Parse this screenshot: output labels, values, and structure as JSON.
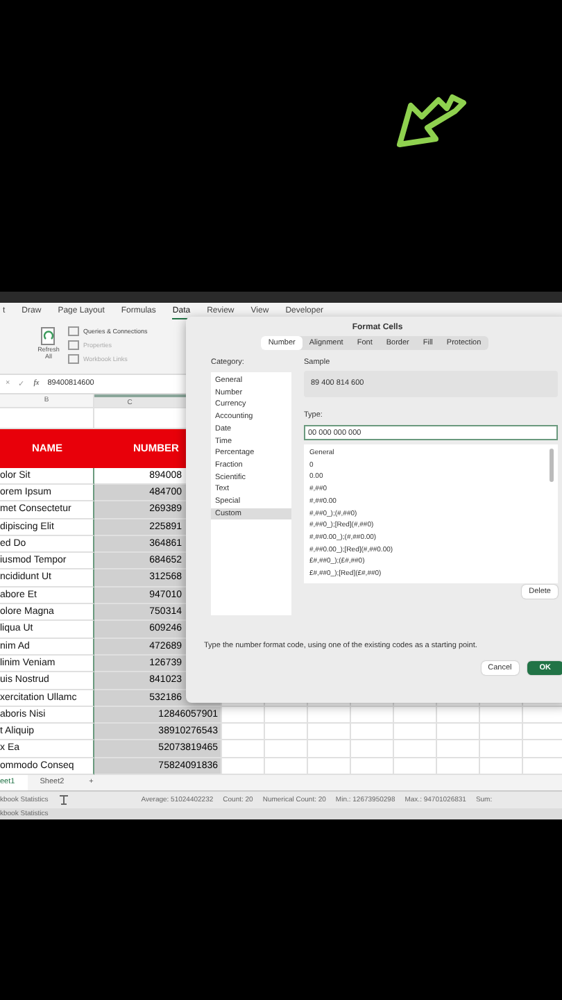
{
  "ribbon_tabs": [
    {
      "label": "t",
      "selected": false
    },
    {
      "label": "Draw",
      "selected": false
    },
    {
      "label": "Page Layout",
      "selected": false
    },
    {
      "label": "Formulas",
      "selected": false
    },
    {
      "label": "Data",
      "selected": true
    },
    {
      "label": "Review",
      "selected": false
    },
    {
      "label": "View",
      "selected": false
    },
    {
      "label": "Developer",
      "selected": false
    }
  ],
  "ribbon": {
    "refresh_label": "Refresh All",
    "commands": [
      {
        "label": "Queries & Connections",
        "disabled": false
      },
      {
        "label": "Properties",
        "disabled": true
      },
      {
        "label": "Workbook Links",
        "disabled": true
      }
    ]
  },
  "formula_bar": {
    "cancel": "×",
    "enter": "✓",
    "fx": "fx",
    "value": "89400814600"
  },
  "columns": [
    "B",
    "C"
  ],
  "table": {
    "headers": [
      "NAME",
      "NUMBER"
    ],
    "rows": [
      {
        "name": "olor Sit",
        "number": "894008",
        "active": true
      },
      {
        "name": "orem Ipsum",
        "number": "484700",
        "active": false
      },
      {
        "name": "met Consectetur",
        "number": "269389",
        "active": false
      },
      {
        "name": "dipiscing Elit",
        "number": "225891",
        "active": false
      },
      {
        "name": "ed Do",
        "number": "364861",
        "active": false
      },
      {
        "name": "iusmod Tempor",
        "number": "684652",
        "active": false
      },
      {
        "name": "ncididunt Ut",
        "number": "312568",
        "active": false
      },
      {
        "name": "abore Et",
        "number": "947010",
        "active": false
      },
      {
        "name": "olore Magna",
        "number": "750314",
        "active": false
      },
      {
        "name": "liqua Ut",
        "number": "609246",
        "active": false
      },
      {
        "name": "nim Ad",
        "number": "472689",
        "active": false
      },
      {
        "name": "linim Veniam",
        "number": "126739",
        "active": false
      },
      {
        "name": "uis Nostrud",
        "number": "841023",
        "active": false
      },
      {
        "name": "xercitation Ullamc",
        "number": "532186",
        "active": false
      },
      {
        "name": "aboris Nisi",
        "number": "12846057901",
        "active": false
      },
      {
        "name": "t Aliquip",
        "number": "38910276543",
        "active": false
      },
      {
        "name": "x Ea",
        "number": "52073819465",
        "active": false
      },
      {
        "name": "ommodo Conseq",
        "number": "75824091836",
        "active": false
      }
    ]
  },
  "sheet_tabs": [
    {
      "label": "eet1",
      "selected": true
    },
    {
      "label": "Sheet2",
      "selected": false
    }
  ],
  "add_sheet": "+",
  "status_bar": {
    "label": "kbook Statistics",
    "stats": [
      "Average: 51024402232",
      "Count: 20",
      "Numerical Count: 20",
      "Min.: 12673950298",
      "Max.: 94701026831",
      "Sum:"
    ],
    "second_label": "kbook Statistics"
  },
  "dialog": {
    "title": "Format Cells",
    "tabs": [
      {
        "label": "Number",
        "selected": true
      },
      {
        "label": "Alignment",
        "selected": false
      },
      {
        "label": "Font",
        "selected": false
      },
      {
        "label": "Border",
        "selected": false
      },
      {
        "label": "Fill",
        "selected": false
      },
      {
        "label": "Protection",
        "selected": false
      }
    ],
    "category_label": "Category:",
    "categories": [
      {
        "label": "General",
        "selected": false
      },
      {
        "label": "Number",
        "selected": false
      },
      {
        "label": "Currency",
        "selected": false
      },
      {
        "label": "Accounting",
        "selected": false
      },
      {
        "label": "Date",
        "selected": false
      },
      {
        "label": "Time",
        "selected": false
      },
      {
        "label": "Percentage",
        "selected": false
      },
      {
        "label": "Fraction",
        "selected": false
      },
      {
        "label": "Scientific",
        "selected": false
      },
      {
        "label": "Text",
        "selected": false
      },
      {
        "label": "Special",
        "selected": false
      },
      {
        "label": "Custom",
        "selected": true
      }
    ],
    "sample_label": "Sample",
    "sample": "89 400 814 600",
    "type_label": "Type:",
    "type_value": "00 000 000 000",
    "type_list": [
      "General",
      "0",
      "0.00",
      "#,##0",
      "#,##0.00",
      "#,##0_);(#,##0)",
      "#,##0_);[Red](#,##0)",
      "#,##0.00_);(#,##0.00)",
      "#,##0.00_);[Red](#,##0.00)",
      "£#,##0_);(£#,##0)",
      "£#,##0_);[Red](£#,##0)"
    ],
    "delete": "Delete",
    "hint": "Type the number format code, using one of the existing codes as a starting point.",
    "cancel": "Cancel",
    "ok": "OK"
  }
}
